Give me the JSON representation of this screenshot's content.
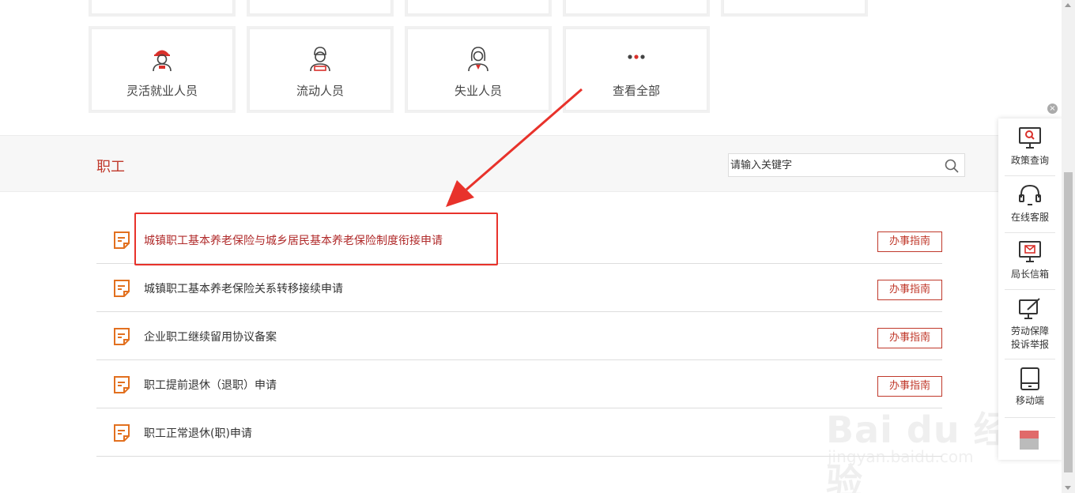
{
  "categories": {
    "cut_row_count": 5,
    "items": [
      {
        "label": "灵活就业人员",
        "icon": "worker-helmet-icon"
      },
      {
        "label": "流动人员",
        "icon": "migrant-person-icon"
      },
      {
        "label": "失业人员",
        "icon": "unemployed-person-icon"
      },
      {
        "label": "查看全部",
        "icon": "more-dots-icon"
      }
    ]
  },
  "section": {
    "title": "职工",
    "search_placeholder": "请输入关键字"
  },
  "services": [
    {
      "name": "城镇职工基本养老保险与城乡居民基本养老保险制度衔接申请",
      "guide": "办事指南",
      "highlighted": true
    },
    {
      "name": "城镇职工基本养老保险关系转移接续申请",
      "guide": "办事指南"
    },
    {
      "name": "企业职工继续留用协议备案",
      "guide": "办事指南"
    },
    {
      "name": "职工提前退休（退职）申请",
      "guide": "办事指南"
    },
    {
      "name": "职工正常退休(职)申请",
      "guide": ""
    }
  ],
  "float_bar": {
    "close_label": "×",
    "items": [
      {
        "label": "政策查询",
        "icon": "policy-search-icon"
      },
      {
        "label": "在线客服",
        "icon": "headset-icon"
      },
      {
        "label": "局长信箱",
        "icon": "mailbox-icon"
      },
      {
        "label": "劳动保障投诉举报",
        "label_line1": "劳动保障",
        "label_line2": "投诉举报",
        "icon": "complaint-report-icon"
      },
      {
        "label": "移动端",
        "icon": "mobile-icon"
      }
    ]
  },
  "watermark": {
    "brand": "Bai du 经验",
    "url": "jingyan.baidu.com"
  },
  "colors": {
    "accent": "#c0392b",
    "annotation": "#e8322b"
  }
}
